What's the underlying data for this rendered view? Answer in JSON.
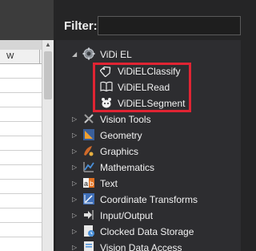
{
  "spreadsheet": {
    "column_header": "W"
  },
  "toolbox": {
    "filter_label": "Filter:",
    "filter_value": "",
    "groups": [
      {
        "label": "ViDi EL",
        "expanded": true,
        "icon": "vidi-el-icon",
        "children": [
          {
            "label": "ViDiELClassify",
            "icon": "tag-icon"
          },
          {
            "label": "ViDiELRead",
            "icon": "book-icon"
          },
          {
            "label": "ViDiELSegment",
            "icon": "segment-icon"
          }
        ]
      },
      {
        "label": "Vision Tools",
        "expanded": false,
        "icon": "vision-tools-icon"
      },
      {
        "label": "Geometry",
        "expanded": false,
        "icon": "geometry-icon"
      },
      {
        "label": "Graphics",
        "expanded": false,
        "icon": "graphics-icon"
      },
      {
        "label": "Mathematics",
        "expanded": false,
        "icon": "mathematics-icon"
      },
      {
        "label": "Text",
        "expanded": false,
        "icon": "text-icon"
      },
      {
        "label": "Coordinate Transforms",
        "expanded": false,
        "icon": "coordinate-transforms-icon"
      },
      {
        "label": "Input/Output",
        "expanded": false,
        "icon": "input-output-icon"
      },
      {
        "label": "Clocked Data Storage",
        "expanded": false,
        "icon": "clocked-data-storage-icon"
      },
      {
        "label": "Vision Data Access",
        "expanded": false,
        "icon": "vision-data-access-icon"
      }
    ]
  },
  "colors": {
    "highlight": "#e02433",
    "panel_bg": "#2d2d30"
  }
}
